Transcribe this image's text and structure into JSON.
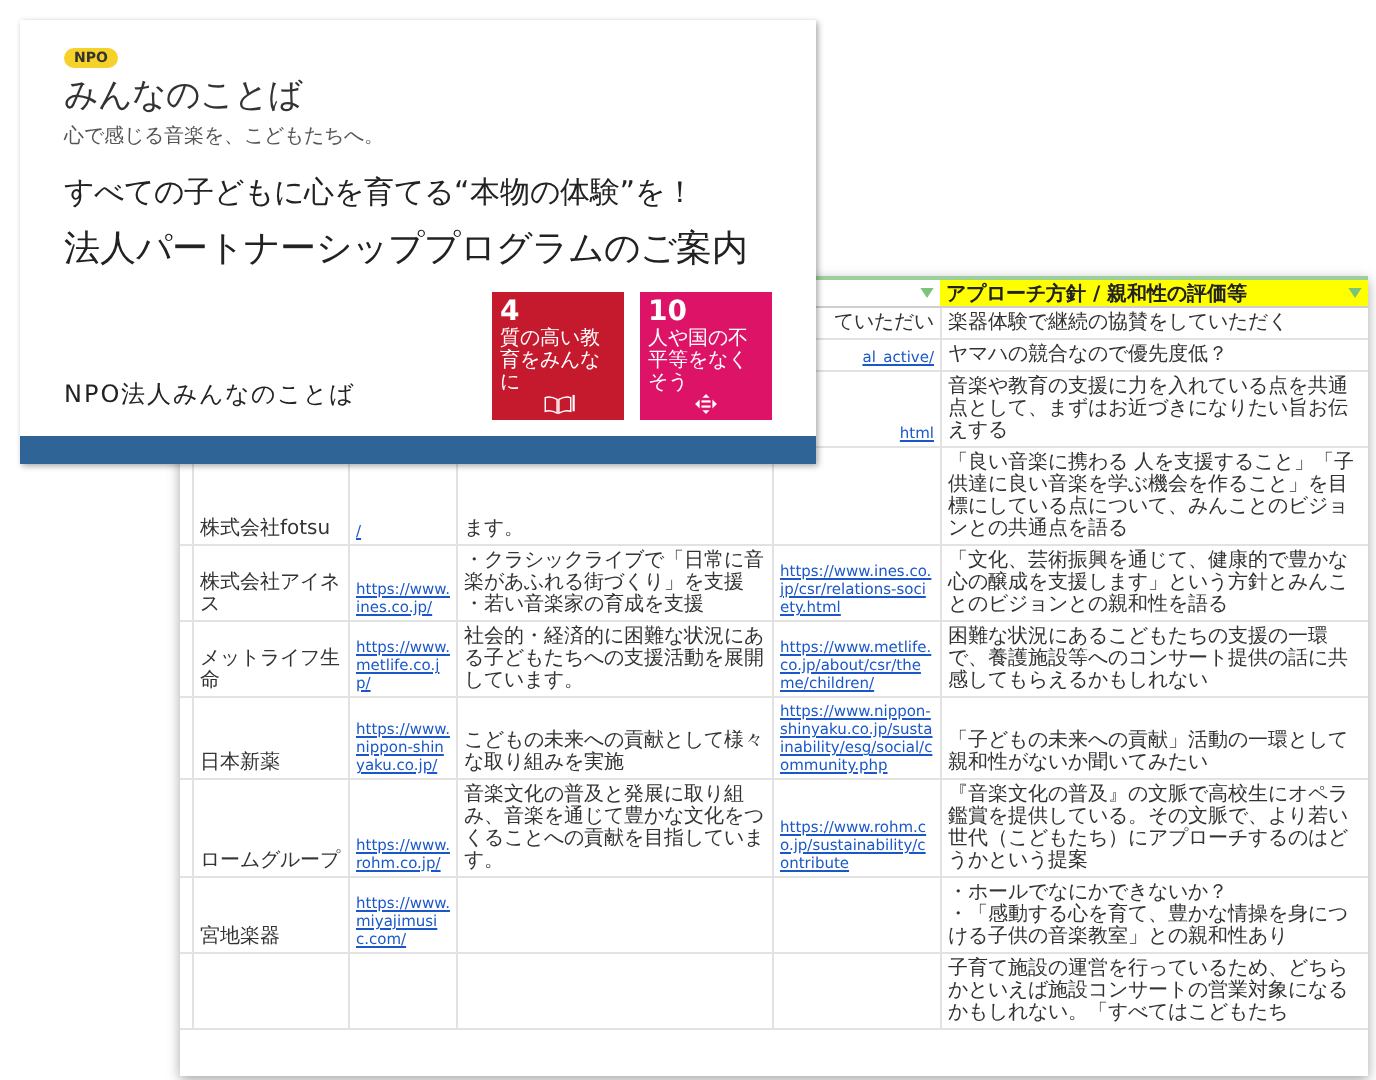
{
  "slide": {
    "badge": "NPO",
    "logo_title": "みんなのことば",
    "tagline": "心で感じる音楽を、こどもたちへ。",
    "subtitle": "すべての子どもに心を育てる“本物の体験”を！",
    "title": "法人パートナーシッププログラムのご案内",
    "organization": "NPO法人みんなのことば",
    "sdg_goals": [
      {
        "number": "4",
        "label": "質の高い教育をみんなに",
        "color": "#c5192d",
        "kind": "education"
      },
      {
        "number": "10",
        "label": "人や国の不平等をなくそう",
        "color": "#dd1367",
        "kind": "equality"
      }
    ]
  },
  "spreadsheet": {
    "header": {
      "column_4": {
        "filter": true
      },
      "column_5": {
        "text": "アプローチ方針 / 親和性の評価等",
        "filter": true,
        "highlighted": true
      }
    },
    "rows": [
      {
        "column_4": {
          "text": "ていただい",
          "kind": "text"
        },
        "column_5": {
          "text": "楽器体験で継続の協賛をしていただく",
          "kind": "text"
        }
      },
      {
        "column_4": {
          "text": "al_active/",
          "kind": "link"
        },
        "column_5": {
          "text": "ヤマハの競合なので優先度低？",
          "kind": "text"
        }
      },
      {
        "column_4": {
          "text": "html",
          "kind": "link"
        },
        "column_5": {
          "text": "音楽や教育の支援に力を入れている点を共通点として、まずはお近づきになりたい旨お伝えする",
          "kind": "text"
        }
      },
      {
        "column_1": {
          "text": "株式会社fotsu",
          "kind": "text"
        },
        "column_2": {
          "text": "/",
          "kind": "link"
        },
        "column_3": {
          "text": "ます。",
          "kind": "text"
        },
        "column_5": {
          "text": "「良い音楽に携わる 人を支援すること」「子供達に良い音楽を学ぶ機会を作ること」を目標にしている点について、みんことのビジョンとの共通点を語る",
          "kind": "text"
        }
      },
      {
        "column_1": {
          "text": "株式会社アイネス",
          "kind": "text"
        },
        "column_2": {
          "text": "https://www.ines.co.jp/",
          "kind": "link"
        },
        "column_3": {
          "items": [
            "・クラシックライブで「日常に音楽があふれる街づくり」を支援",
            "・若い音楽家の育成を支援"
          ],
          "kind": "list"
        },
        "column_4": {
          "text": "https://www.ines.co.jp/csr/relations-society.html",
          "kind": "link"
        },
        "column_5": {
          "text": "「文化、芸術振興を通じて、健康的で豊かな心の醸成を支援します」という方針とみんことのビジョンとの親和性を語る",
          "kind": "text"
        }
      },
      {
        "column_1": {
          "text": "メットライフ生命",
          "kind": "text"
        },
        "column_2": {
          "text": "https://www.metlife.co.jp/",
          "kind": "link"
        },
        "column_3": {
          "text": "社会的・経済的に困難な状況にある子どもたちへの支援活動を展開しています。",
          "kind": "text"
        },
        "column_4": {
          "text": "https://www.metlife.co.jp/about/csr/theme/children/",
          "kind": "link"
        },
        "column_5": {
          "text": "困難な状況にあるこどもたちの支援の一環で、養護施設等へのコンサート提供の話に共感してもらえるかもしれない",
          "kind": "text"
        }
      },
      {
        "column_1": {
          "text": "日本新薬",
          "kind": "text"
        },
        "column_2": {
          "text": "https://www.nippon-shinyaku.co.jp/",
          "kind": "link"
        },
        "column_3": {
          "text": "こどもの未来への貢献として様々な取り組みを実施",
          "kind": "text"
        },
        "column_4": {
          "text": "https://www.nippon-shinyaku.co.jp/sustainability/esg/social/community.php",
          "kind": "link"
        },
        "column_5": {
          "text": "「子どもの未来への貢献」活動の一環として親和性がないか聞いてみたい",
          "kind": "text"
        }
      },
      {
        "column_1": {
          "text": "ロームグループ",
          "kind": "text"
        },
        "column_2": {
          "text": "https://www.rohm.co.jp/",
          "kind": "link"
        },
        "column_3": {
          "text": "音楽文化の普及と発展に取り組み、音楽を通じて豊かな文化をつくることへの貢献を目指しています。",
          "kind": "text"
        },
        "column_4": {
          "text": "https://www.rohm.co.jp/sustainability/contribute",
          "kind": "link"
        },
        "column_5": {
          "text": "『音楽文化の普及』の文脈で高校生にオペラ鑑賞を提供している。その文脈で、より若い世代（こどもたち）にアプローチするのはどうかという提案",
          "kind": "text"
        }
      },
      {
        "column_1": {
          "text": "宮地楽器",
          "kind": "text"
        },
        "column_2": {
          "text": "https://www.miyajimusic.com/",
          "kind": "link"
        },
        "column_5": {
          "items": [
            "・ホールでなにかできないか？",
            "・「感動する心を育て、豊かな情操を身につける子供の音楽教室」との親和性あり"
          ],
          "kind": "list"
        }
      },
      {
        "column_5": {
          "text": "子育て施設の運営を行っているため、どちらかといえば施設コンサートの営業対象になるかもしれない。「すべてはこどもたち",
          "kind": "text"
        }
      }
    ]
  }
}
